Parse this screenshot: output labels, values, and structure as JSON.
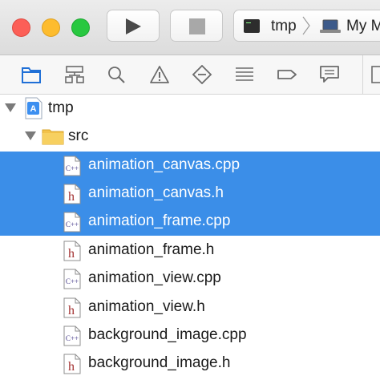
{
  "window": {
    "controls": [
      "close",
      "minimize",
      "zoom"
    ]
  },
  "toolbar": {
    "run_icon": "play-icon",
    "stop_icon": "stop-icon",
    "scheme": {
      "target": "tmp",
      "device": "My M"
    }
  },
  "navigator_tabs": [
    {
      "icon": "folder-icon",
      "active": true
    },
    {
      "icon": "hierarchy-icon",
      "active": false
    },
    {
      "icon": "search-icon",
      "active": false
    },
    {
      "icon": "warning-icon",
      "active": false
    },
    {
      "icon": "diamond-minus-icon",
      "active": false
    },
    {
      "icon": "list-icon",
      "active": false
    },
    {
      "icon": "tag-icon",
      "active": false
    },
    {
      "icon": "speech-bubble-icon",
      "active": false
    }
  ],
  "colors": {
    "selection": "#3b8ee8",
    "accent": "#1f6fd6",
    "header_h": "#a12d2d",
    "cpp": "#4a3f8c"
  },
  "tree": {
    "project": "tmp",
    "folder": "src",
    "files": [
      {
        "name": "animation_canvas.cpp",
        "kind": "cpp",
        "selected": true
      },
      {
        "name": "animation_canvas.h",
        "kind": "h",
        "selected": true
      },
      {
        "name": "animation_frame.cpp",
        "kind": "cpp",
        "selected": true
      },
      {
        "name": "animation_frame.h",
        "kind": "h",
        "selected": false
      },
      {
        "name": "animation_view.cpp",
        "kind": "cpp",
        "selected": false
      },
      {
        "name": "animation_view.h",
        "kind": "h",
        "selected": false
      },
      {
        "name": "background_image.cpp",
        "kind": "cpp",
        "selected": false
      },
      {
        "name": "background_image.h",
        "kind": "h",
        "selected": false
      }
    ]
  }
}
